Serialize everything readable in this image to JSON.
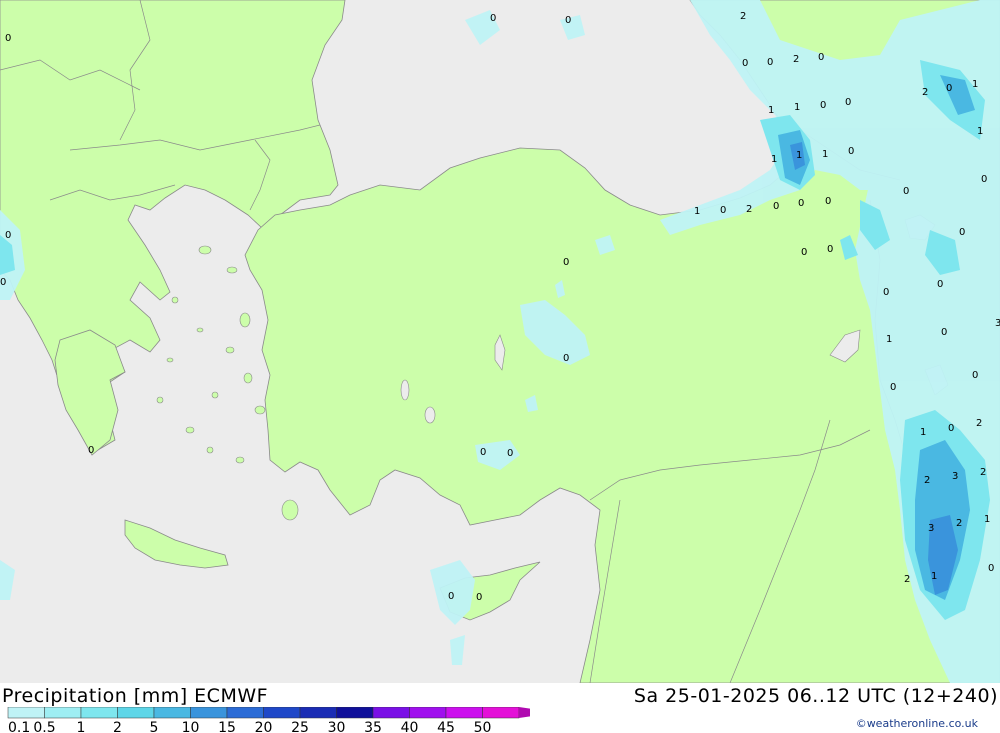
{
  "footer": {
    "title": "Precipitation [mm] ECMWF",
    "valid_time": "Sa 25-01-2025 06..12 UTC (12+240)",
    "credit": "©weatheronline.co.uk"
  },
  "legend": {
    "ticks": [
      "0.1",
      "0.5",
      "1",
      "2",
      "5",
      "10",
      "15",
      "20",
      "25",
      "30",
      "35",
      "40",
      "45",
      "50"
    ],
    "colors": [
      "#bff3f6",
      "#9eeef3",
      "#7ee6ee",
      "#5ed6e8",
      "#4ab8e2",
      "#3a94dc",
      "#2c6cd6",
      "#1f48c8",
      "#1a2cb4",
      "#10109a",
      "#7a10e6",
      "#a010ee",
      "#cc10ee",
      "#e410d8",
      "#b00ab0"
    ]
  },
  "colors": {
    "sea": "#ececec",
    "land": "#ccfeaa",
    "border": "#8a8a8a"
  },
  "map_labels": [
    {
      "id": "p1",
      "text": "2"
    },
    {
      "id": "p2",
      "text": "0"
    },
    {
      "id": "p3",
      "text": "0"
    },
    {
      "id": "p4",
      "text": "0"
    },
    {
      "id": "p5",
      "text": "0"
    },
    {
      "id": "p6",
      "text": "0"
    },
    {
      "id": "p7",
      "text": "2"
    },
    {
      "id": "p8",
      "text": "1"
    },
    {
      "id": "p9",
      "text": "0"
    },
    {
      "id": "p10",
      "text": "0"
    },
    {
      "id": "p11",
      "text": "2"
    },
    {
      "id": "p12",
      "text": "0"
    },
    {
      "id": "p13",
      "text": "1"
    },
    {
      "id": "p14",
      "text": "1"
    },
    {
      "id": "p15",
      "text": "1"
    },
    {
      "id": "p16",
      "text": "1"
    },
    {
      "id": "p17",
      "text": "0"
    },
    {
      "id": "p18",
      "text": "0"
    },
    {
      "id": "p19",
      "text": "1"
    },
    {
      "id": "p20",
      "text": "0"
    },
    {
      "id": "p21",
      "text": "2"
    },
    {
      "id": "p22",
      "text": "0"
    },
    {
      "id": "p23",
      "text": "0"
    },
    {
      "id": "p24",
      "text": "0"
    },
    {
      "id": "p25",
      "text": "0"
    },
    {
      "id": "p26",
      "text": "0"
    },
    {
      "id": "p27",
      "text": "0"
    },
    {
      "id": "p28",
      "text": "1"
    },
    {
      "id": "p29",
      "text": "1"
    },
    {
      "id": "p30",
      "text": "0"
    },
    {
      "id": "p31",
      "text": "0"
    },
    {
      "id": "p32",
      "text": "0"
    },
    {
      "id": "p33",
      "text": "0"
    },
    {
      "id": "p34",
      "text": "0"
    },
    {
      "id": "p35",
      "text": "0"
    },
    {
      "id": "p36",
      "text": "1"
    },
    {
      "id": "p37",
      "text": "0"
    },
    {
      "id": "p38",
      "text": "0"
    },
    {
      "id": "p39",
      "text": "3"
    },
    {
      "id": "p40",
      "text": "1"
    },
    {
      "id": "p41",
      "text": "0"
    },
    {
      "id": "p42",
      "text": "2"
    },
    {
      "id": "p43",
      "text": "2"
    },
    {
      "id": "p44",
      "text": "3"
    },
    {
      "id": "p45",
      "text": "2"
    },
    {
      "id": "p46",
      "text": "3"
    },
    {
      "id": "p47",
      "text": "2"
    },
    {
      "id": "p48",
      "text": "1"
    },
    {
      "id": "p49",
      "text": "2"
    },
    {
      "id": "p50",
      "text": "1"
    },
    {
      "id": "p51",
      "text": "0"
    },
    {
      "id": "p52",
      "text": "0"
    },
    {
      "id": "p53",
      "text": "0"
    },
    {
      "id": "p54",
      "text": "0"
    },
    {
      "id": "p55",
      "text": "0"
    },
    {
      "id": "p56",
      "text": "0"
    },
    {
      "id": "p57",
      "text": "0"
    },
    {
      "id": "p58",
      "text": "0"
    },
    {
      "id": "p59",
      "text": "0"
    }
  ]
}
